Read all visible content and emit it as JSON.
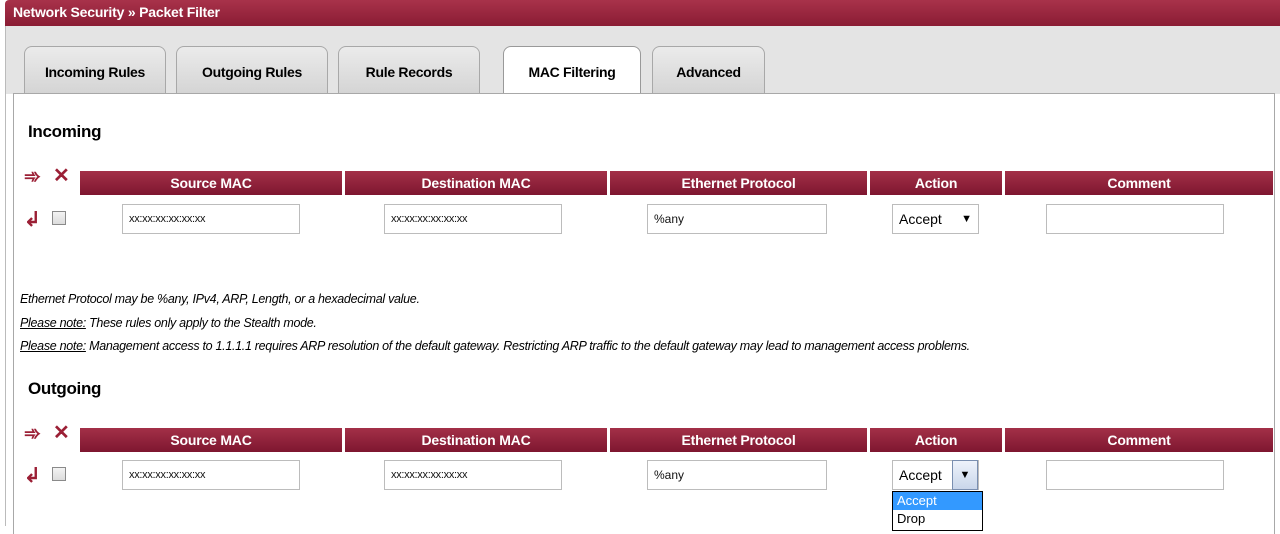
{
  "title": "Network Security » Packet Filter",
  "tabs": [
    {
      "label": "Incoming Rules"
    },
    {
      "label": "Outgoing Rules"
    },
    {
      "label": "Rule Records"
    },
    {
      "label": "MAC Filtering",
      "active": true
    },
    {
      "label": "Advanced"
    }
  ],
  "columns": [
    "Source MAC",
    "Destination MAC",
    "Ethernet Protocol",
    "Action",
    "Comment"
  ],
  "incoming": {
    "title": "Incoming",
    "row": {
      "source_mac": "xx:xx:xx:xx:xx:xx",
      "destination_mac": "xx:xx:xx:xx:xx:xx",
      "ethernet_protocol": "%any",
      "action": "Accept",
      "comment": ""
    }
  },
  "notes": {
    "line1": "Ethernet Protocol may be %any, IPv4, ARP, Length, or a hexadecimal value.",
    "please_note_label": "Please note:",
    "line2": " These rules only apply to the Stealth mode.",
    "line3": " Management access to 1.1.1.1 requires ARP resolution of the default gateway. Restricting ARP traffic to the default gateway may lead to management access problems."
  },
  "outgoing": {
    "title": "Outgoing",
    "row": {
      "source_mac": "xx:xx:xx:xx:xx:xx",
      "destination_mac": "xx:xx:xx:xx:xx:xx",
      "ethernet_protocol": "%any",
      "action": "Accept",
      "comment": ""
    },
    "action_options": [
      "Accept",
      "Drop"
    ]
  },
  "colors": {
    "accent": "#9b1f35",
    "header_bg": "#8a1c34",
    "highlight": "#3399ff"
  }
}
